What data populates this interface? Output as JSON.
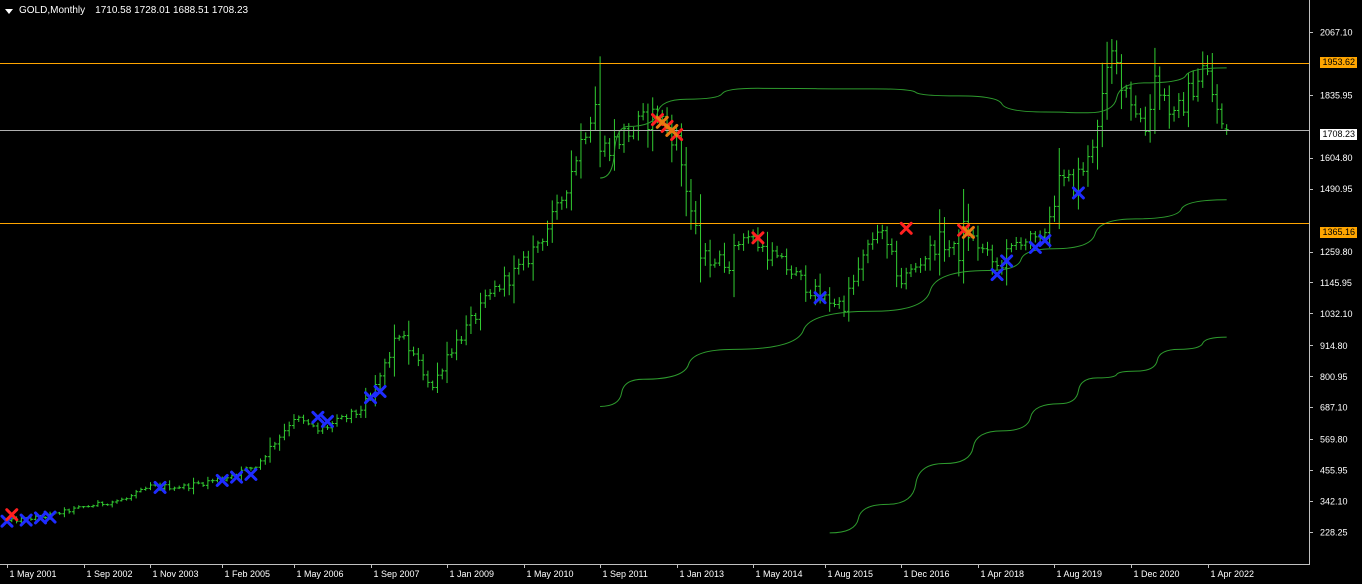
{
  "window": {
    "symbol_title": "GOLD,Monthly",
    "ohlc": "1710.58 1728.01 1688.51 1708.23",
    "menu_icon": "triangle-down-icon"
  },
  "colors": {
    "background": "#000000",
    "grid_border": "#c0c0c0",
    "bar": "#32cd32",
    "moving_average": "#2e9b2e",
    "resistance_line": "#ffa500",
    "current_price_line": "#b0b0b0",
    "buy_marker": "#1e2cff",
    "sell_marker": "#ff2020",
    "axis_text": "#ffffff"
  },
  "price_axis": {
    "labels": [
      "2067.10",
      "1953.62",
      "1835.95",
      "1708.23",
      "1604.80",
      "1490.95",
      "1365.16",
      "1259.80",
      "1145.95",
      "1032.10",
      "914.80",
      "800.95",
      "687.10",
      "569.80",
      "455.95",
      "342.10",
      "228.25"
    ],
    "tick_values": [
      2067.1,
      1835.95,
      1604.8,
      1490.95,
      1259.8,
      1145.95,
      1032.1,
      914.8,
      800.95,
      687.1,
      569.8,
      455.95,
      342.1,
      228.25
    ]
  },
  "levels": {
    "resistance_upper": {
      "label": "1953.62",
      "value": 1953.62
    },
    "current_price": {
      "label": "1708.23",
      "value": 1708.23
    },
    "resistance_lower": {
      "label": "1365.16",
      "value": 1365.16
    }
  },
  "time_axis": {
    "labels": [
      "1 May 2001",
      "1 Sep 2002",
      "1 Nov 2003",
      "1 Feb 2005",
      "1 May 2006",
      "1 Sep 2007",
      "1 Jan 2009",
      "1 May 2010",
      "1 Sep 2011",
      "1 Jan 2013",
      "1 May 2014",
      "1 Aug 2015",
      "1 Dec 2016",
      "1 Apr 2018",
      "1 Aug 2019",
      "1 Dec 2020",
      "1 Apr 2022"
    ]
  },
  "chart_data": {
    "type": "ohlc-bar",
    "symbol": "GOLD",
    "timeframe": "Monthly",
    "y_range": [
      228.25,
      2067.1
    ],
    "price_path": [
      [
        "2001-05",
        268
      ],
      [
        "2002-01",
        285
      ],
      [
        "2002-09",
        320
      ],
      [
        "2003-06",
        350
      ],
      [
        "2003-11",
        395
      ],
      [
        "2004-06",
        395
      ],
      [
        "2005-02",
        425
      ],
      [
        "2005-09",
        470
      ],
      [
        "2006-05",
        650
      ],
      [
        "2006-10",
        600
      ],
      [
        "2007-06",
        665
      ],
      [
        "2007-09",
        720
      ],
      [
        "2008-03",
        960
      ],
      [
        "2008-10",
        760
      ],
      [
        "2009-01",
        880
      ],
      [
        "2009-11",
        1120
      ],
      [
        "2010-05",
        1210
      ],
      [
        "2010-12",
        1405
      ],
      [
        "2011-08",
        1820
      ],
      [
        "2011-09",
        1630
      ],
      [
        "2012-09",
        1770
      ],
      [
        "2013-01",
        1665
      ],
      [
        "2013-06",
        1240
      ],
      [
        "2013-12",
        1220
      ],
      [
        "2014-03",
        1330
      ],
      [
        "2014-12",
        1200
      ],
      [
        "2015-07",
        1090
      ],
      [
        "2015-12",
        1065
      ],
      [
        "2016-07",
        1350
      ],
      [
        "2016-12",
        1150
      ],
      [
        "2017-08",
        1300
      ],
      [
        "2017-12",
        1250
      ],
      [
        "2018-01",
        1345
      ],
      [
        "2018-08",
        1200
      ],
      [
        "2019-01",
        1310
      ],
      [
        "2019-05",
        1285
      ],
      [
        "2019-09",
        1510
      ],
      [
        "2019-12",
        1515
      ],
      [
        "2020-03",
        1590
      ],
      [
        "2020-08",
        1975
      ],
      [
        "2021-03",
        1710
      ],
      [
        "2021-05",
        1905
      ],
      [
        "2021-09",
        1745
      ],
      [
        "2022-03",
        1935
      ],
      [
        "2022-04",
        1905
      ],
      [
        "2022-07",
        1710
      ],
      [
        "2022-08",
        1708
      ]
    ],
    "moving_averages": [
      {
        "points": [
          [
            "2011-09",
            1530
          ],
          [
            "2012-03",
            1720
          ],
          [
            "2013-03",
            1820
          ],
          [
            "2014-06",
            1860
          ],
          [
            "2016-06",
            1858
          ],
          [
            "2017-12",
            1832
          ],
          [
            "2019-06",
            1773
          ],
          [
            "2020-03",
            1770
          ],
          [
            "2021-03",
            1880
          ],
          [
            "2022-08",
            1935
          ]
        ]
      },
      {
        "points": [
          [
            "2011-09",
            690
          ],
          [
            "2012-06",
            790
          ],
          [
            "2014-01",
            900
          ],
          [
            "2016-06",
            1040
          ],
          [
            "2018-06",
            1190
          ],
          [
            "2019-08",
            1270
          ],
          [
            "2021-01",
            1380
          ],
          [
            "2022-08",
            1450
          ]
        ]
      },
      {
        "points": [
          [
            "2015-09",
            225
          ],
          [
            "2016-09",
            330
          ],
          [
            "2017-09",
            480
          ],
          [
            "2018-09",
            600
          ],
          [
            "2019-09",
            700
          ],
          [
            "2020-05",
            795
          ],
          [
            "2021-01",
            820
          ],
          [
            "2021-10",
            900
          ],
          [
            "2022-08",
            945
          ]
        ]
      }
    ],
    "buy_signals": [
      [
        "2001-05",
        268
      ],
      [
        "2001-09",
        272
      ],
      [
        "2001-12",
        280
      ],
      [
        "2002-02",
        283
      ],
      [
        "2004-01",
        392
      ],
      [
        "2005-02",
        418
      ],
      [
        "2005-05",
        430
      ],
      [
        "2005-08",
        440
      ],
      [
        "2006-10",
        650
      ],
      [
        "2006-12",
        635
      ],
      [
        "2007-09",
        722
      ],
      [
        "2007-11",
        745
      ],
      [
        "2015-07",
        1090
      ],
      [
        "2018-08",
        1175
      ],
      [
        "2018-10",
        1225
      ],
      [
        "2019-04",
        1275
      ],
      [
        "2019-06",
        1300
      ],
      [
        "2020-01",
        1475
      ]
    ],
    "sell_signals": [
      [
        "2001-06",
        292
      ],
      [
        "2012-09",
        1745
      ],
      [
        "2012-11",
        1720
      ],
      [
        "2013-01",
        1690
      ],
      [
        "2014-06",
        1310
      ],
      [
        "2017-01",
        1345
      ],
      [
        "2018-01",
        1338
      ]
    ],
    "pending_signals": [
      [
        "2012-10",
        1735
      ],
      [
        "2012-12",
        1705
      ],
      [
        "2018-02",
        1330
      ]
    ]
  }
}
